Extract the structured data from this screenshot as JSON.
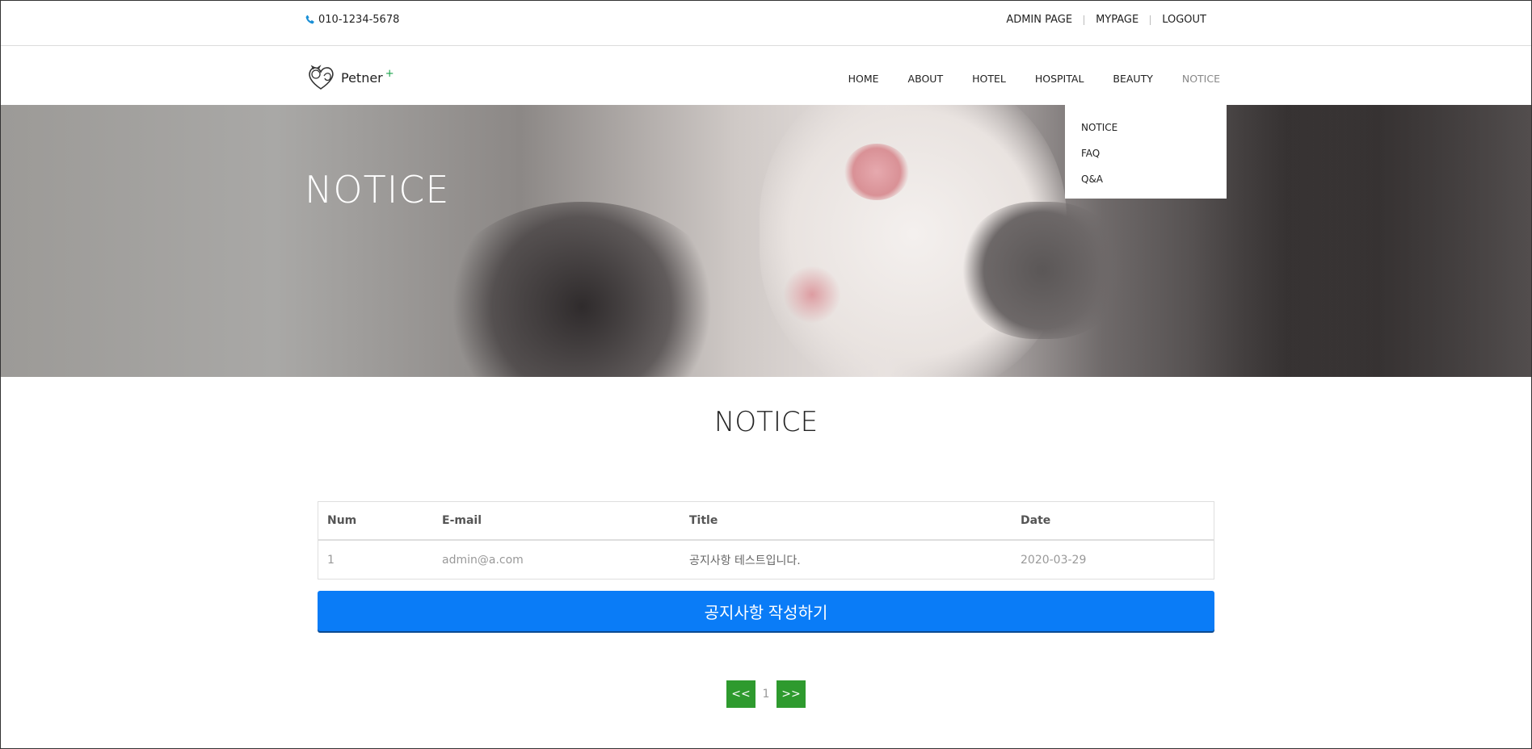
{
  "topbar": {
    "phone": "010-1234-5678",
    "links": [
      "ADMIN PAGE",
      "MYPAGE",
      "LOGOUT"
    ]
  },
  "brand": {
    "name": "Petner",
    "plus": "+"
  },
  "nav": {
    "items": [
      "HOME",
      "ABOUT",
      "HOTEL",
      "HOSPITAL",
      "BEAUTY",
      "NOTICE"
    ],
    "active": "NOTICE"
  },
  "dropdown": {
    "items": [
      "NOTICE",
      "FAQ",
      "Q&A"
    ]
  },
  "hero": {
    "title": "NOTICE"
  },
  "section": {
    "title": "NOTICE"
  },
  "table": {
    "headers": [
      "Num",
      "E-mail",
      "Title",
      "Date"
    ],
    "rows": [
      {
        "num": "1",
        "email": "admin@a.com",
        "title": "공지사항 테스트입니다.",
        "date": "2020-03-29"
      }
    ]
  },
  "write_button": "공지사항 작성하기",
  "pagination": {
    "prev": "<<",
    "page": "1",
    "next": ">>"
  },
  "colors": {
    "primary_button": "#0a7cf7",
    "pager_button": "#2e9a2e",
    "phone_icon": "#1a8fd6",
    "brand_plus": "#1aa34a"
  }
}
